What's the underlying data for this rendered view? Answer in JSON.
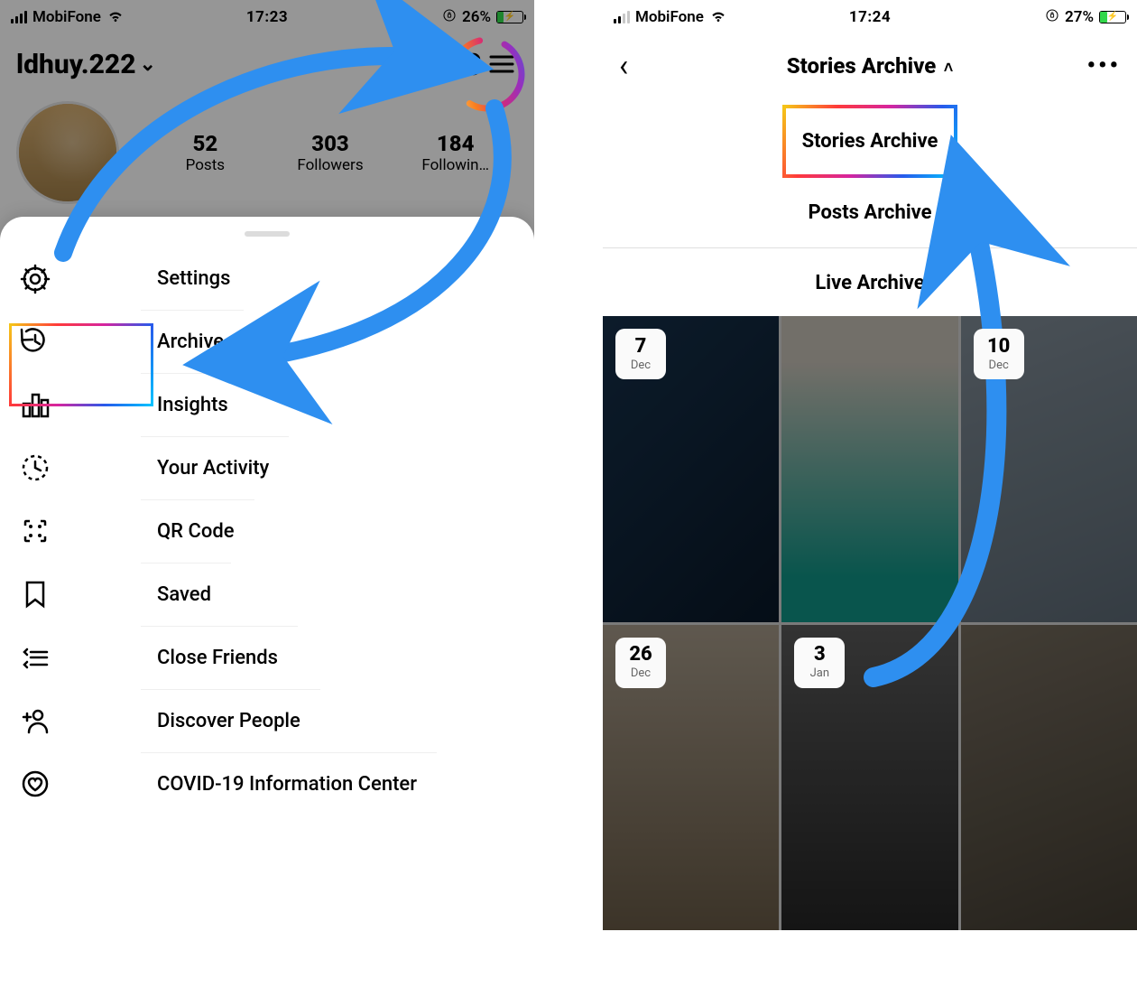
{
  "left": {
    "status": {
      "carrier": "MobiFone",
      "time": "17:23",
      "battery_pct": "26%"
    },
    "profile": {
      "username": "ldhuy.222",
      "stats": {
        "posts_num": "52",
        "posts_lab": "Posts",
        "followers_num": "303",
        "followers_lab": "Followers",
        "following_num": "184",
        "following_lab": "Followin…"
      }
    },
    "menu": {
      "settings": "Settings",
      "archive": "Archive",
      "insights": "Insights",
      "activity": "Your Activity",
      "qr": "QR Code",
      "saved": "Saved",
      "close_friends": "Close Friends",
      "discover": "Discover People",
      "covid": "COVID-19 Information Center"
    }
  },
  "right": {
    "status": {
      "carrier": "MobiFone",
      "time": "17:24",
      "battery_pct": "27%"
    },
    "header_title": "Stories Archive",
    "dropdown": {
      "stories": "Stories Archive",
      "posts": "Posts Archive",
      "live": "Live Archive"
    },
    "dates": {
      "d1": {
        "d": "7",
        "m": "Dec"
      },
      "d3": {
        "d": "10",
        "m": "Dec"
      },
      "d4": {
        "d": "26",
        "m": "Dec"
      },
      "d5": {
        "d": "3",
        "m": "Jan"
      }
    }
  },
  "colors": {
    "annotation": "#1E90FF"
  }
}
